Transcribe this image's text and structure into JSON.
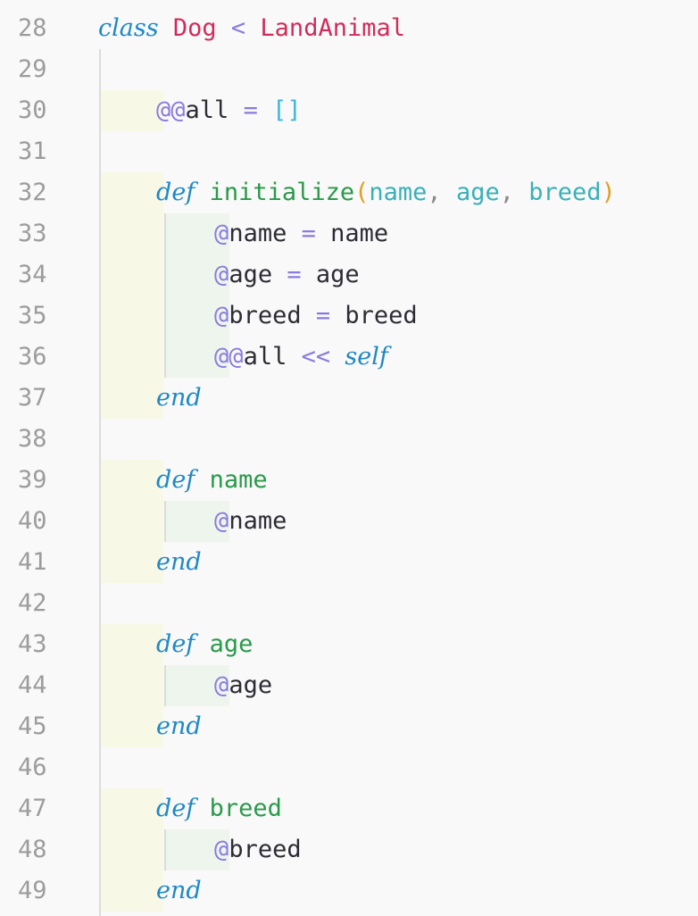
{
  "editor": {
    "lines": [
      {
        "num": "28",
        "tokens": [
          {
            "t": "class",
            "c": "kw"
          },
          {
            "t": " "
          },
          {
            "t": "Dog",
            "c": "const"
          },
          {
            "t": " "
          },
          {
            "t": "<",
            "c": "op"
          },
          {
            "t": " "
          },
          {
            "t": "LandAnimal",
            "c": "const"
          }
        ]
      },
      {
        "num": "29",
        "tokens": []
      },
      {
        "num": "30",
        "tokens": [
          {
            "t": "    "
          },
          {
            "t": "@@",
            "c": "ivar"
          },
          {
            "t": "all"
          },
          {
            "t": " "
          },
          {
            "t": "=",
            "c": "op"
          },
          {
            "t": " "
          },
          {
            "t": "[]",
            "c": "br"
          }
        ]
      },
      {
        "num": "31",
        "tokens": []
      },
      {
        "num": "32",
        "tokens": [
          {
            "t": "    "
          },
          {
            "t": "def",
            "c": "kw"
          },
          {
            "t": " "
          },
          {
            "t": "initialize",
            "c": "meth"
          },
          {
            "t": "(",
            "c": "paren"
          },
          {
            "t": "name",
            "c": "param"
          },
          {
            "t": ", ",
            "c": "punc"
          },
          {
            "t": "age",
            "c": "param"
          },
          {
            "t": ", ",
            "c": "punc"
          },
          {
            "t": "breed",
            "c": "param"
          },
          {
            "t": ")",
            "c": "paren"
          }
        ]
      },
      {
        "num": "33",
        "tokens": [
          {
            "t": "        "
          },
          {
            "t": "@",
            "c": "ivar"
          },
          {
            "t": "name"
          },
          {
            "t": " "
          },
          {
            "t": "=",
            "c": "op"
          },
          {
            "t": " name"
          }
        ]
      },
      {
        "num": "34",
        "tokens": [
          {
            "t": "        "
          },
          {
            "t": "@",
            "c": "ivar"
          },
          {
            "t": "age"
          },
          {
            "t": " "
          },
          {
            "t": "=",
            "c": "op"
          },
          {
            "t": " age"
          }
        ]
      },
      {
        "num": "35",
        "tokens": [
          {
            "t": "        "
          },
          {
            "t": "@",
            "c": "ivar"
          },
          {
            "t": "breed"
          },
          {
            "t": " "
          },
          {
            "t": "=",
            "c": "op"
          },
          {
            "t": " breed"
          }
        ]
      },
      {
        "num": "36",
        "tokens": [
          {
            "t": "        "
          },
          {
            "t": "@@",
            "c": "ivar"
          },
          {
            "t": "all"
          },
          {
            "t": " "
          },
          {
            "t": "<<",
            "c": "op"
          },
          {
            "t": " "
          },
          {
            "t": "self",
            "c": "kw"
          }
        ]
      },
      {
        "num": "37",
        "tokens": [
          {
            "t": "    "
          },
          {
            "t": "end",
            "c": "kw"
          }
        ]
      },
      {
        "num": "38",
        "tokens": []
      },
      {
        "num": "39",
        "tokens": [
          {
            "t": "    "
          },
          {
            "t": "def",
            "c": "kw"
          },
          {
            "t": " "
          },
          {
            "t": "name",
            "c": "meth"
          }
        ]
      },
      {
        "num": "40",
        "tokens": [
          {
            "t": "        "
          },
          {
            "t": "@",
            "c": "ivar"
          },
          {
            "t": "name"
          }
        ]
      },
      {
        "num": "41",
        "tokens": [
          {
            "t": "    "
          },
          {
            "t": "end",
            "c": "kw"
          }
        ]
      },
      {
        "num": "42",
        "tokens": []
      },
      {
        "num": "43",
        "tokens": [
          {
            "t": "    "
          },
          {
            "t": "def",
            "c": "kw"
          },
          {
            "t": " "
          },
          {
            "t": "age",
            "c": "meth"
          }
        ]
      },
      {
        "num": "44",
        "tokens": [
          {
            "t": "        "
          },
          {
            "t": "@",
            "c": "ivar"
          },
          {
            "t": "age"
          }
        ]
      },
      {
        "num": "45",
        "tokens": [
          {
            "t": "    "
          },
          {
            "t": "end",
            "c": "kw"
          }
        ]
      },
      {
        "num": "46",
        "tokens": []
      },
      {
        "num": "47",
        "tokens": [
          {
            "t": "    "
          },
          {
            "t": "def",
            "c": "kw"
          },
          {
            "t": " "
          },
          {
            "t": "breed",
            "c": "meth"
          }
        ]
      },
      {
        "num": "48",
        "tokens": [
          {
            "t": "        "
          },
          {
            "t": "@",
            "c": "ivar"
          },
          {
            "t": "breed"
          }
        ]
      },
      {
        "num": "49",
        "tokens": [
          {
            "t": "    "
          },
          {
            "t": "end",
            "c": "kw"
          }
        ]
      }
    ]
  },
  "colors": {
    "background": "#f9f9f9",
    "keyword": "#1e88c8",
    "constant": "#d22b5b",
    "operator": "#8a7be0",
    "method": "#2a9a4a",
    "parameter": "#3ab0b8",
    "paren": "#e0a020",
    "line_number": "#9c9c9c"
  }
}
